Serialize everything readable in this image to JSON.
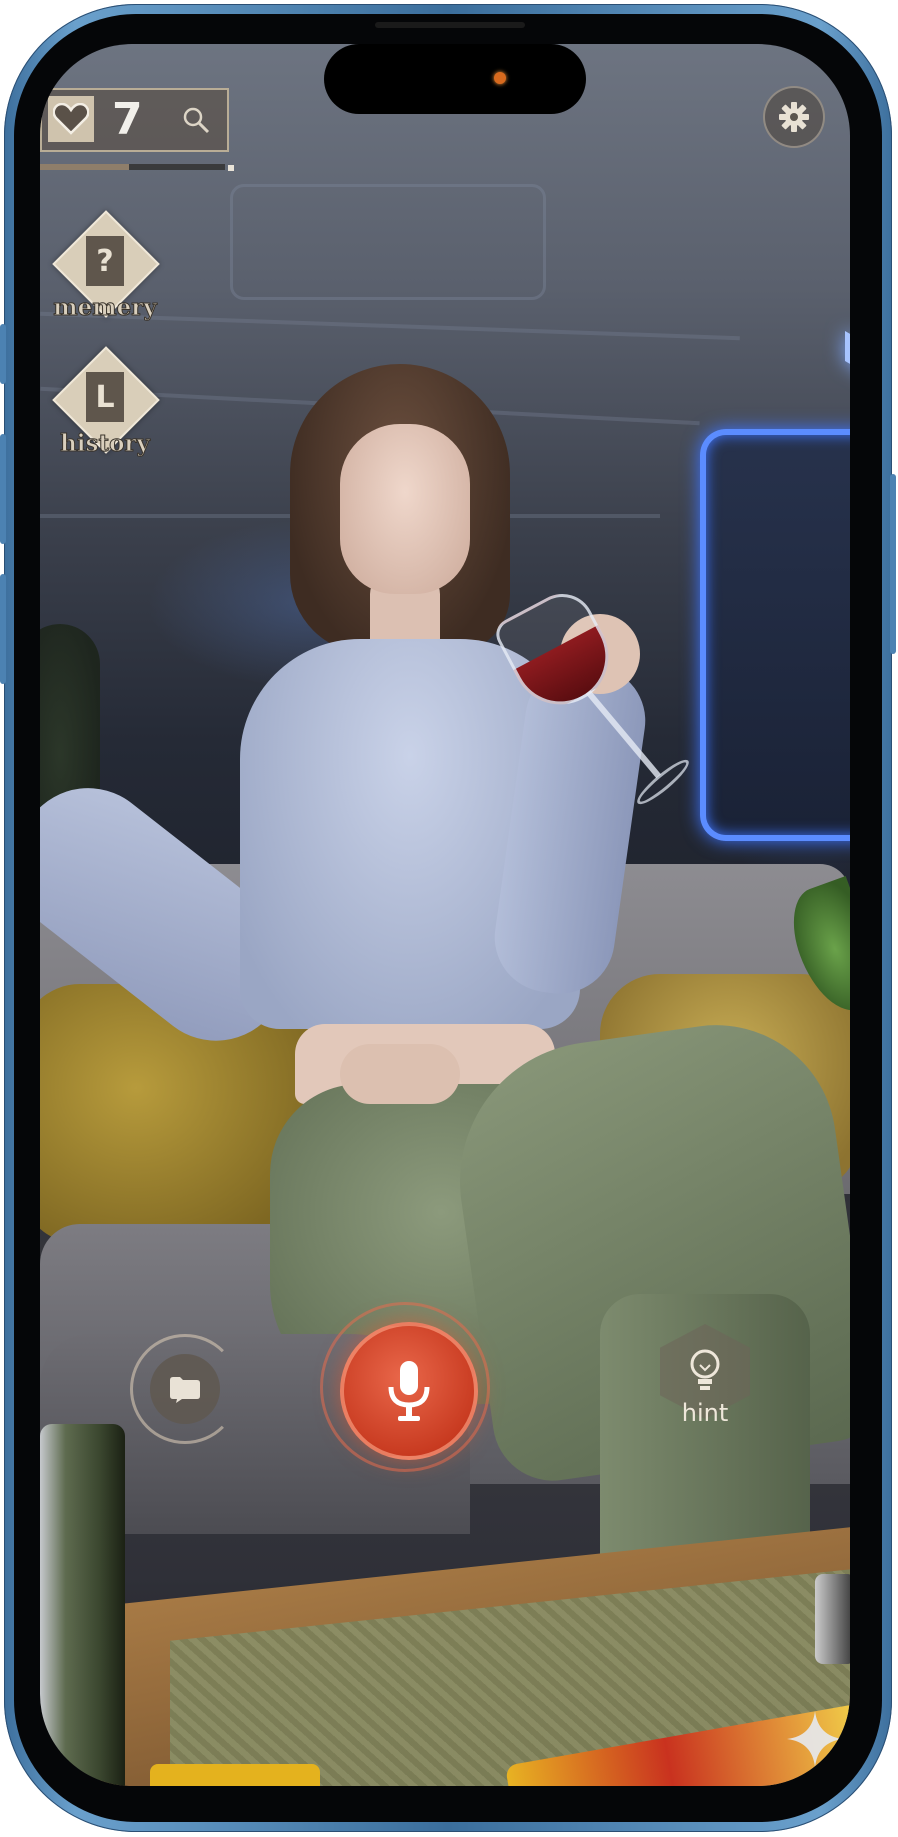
{
  "hud": {
    "heart_icon": "heart-icon",
    "count": "7",
    "search_icon": "search-icon",
    "progress_fraction": 0.48,
    "accent": "#cfc3ad"
  },
  "settings": {
    "icon": "gear-icon"
  },
  "side_buttons": [
    {
      "glyph": "?",
      "label": "memery",
      "icon": "question-mark-icon"
    },
    {
      "glyph": "L",
      "label": "history",
      "icon": "history-icon"
    }
  ],
  "controls": {
    "files_icon": "folder-chat-icon",
    "mic_icon": "microphone-icon",
    "mic_color": "#d9482b",
    "hint_icon": "lightbulb-icon",
    "hint_label": "hint",
    "sparkle_icon": "sparkle-icon"
  },
  "device": {
    "frame_color": "#4c82b2"
  }
}
